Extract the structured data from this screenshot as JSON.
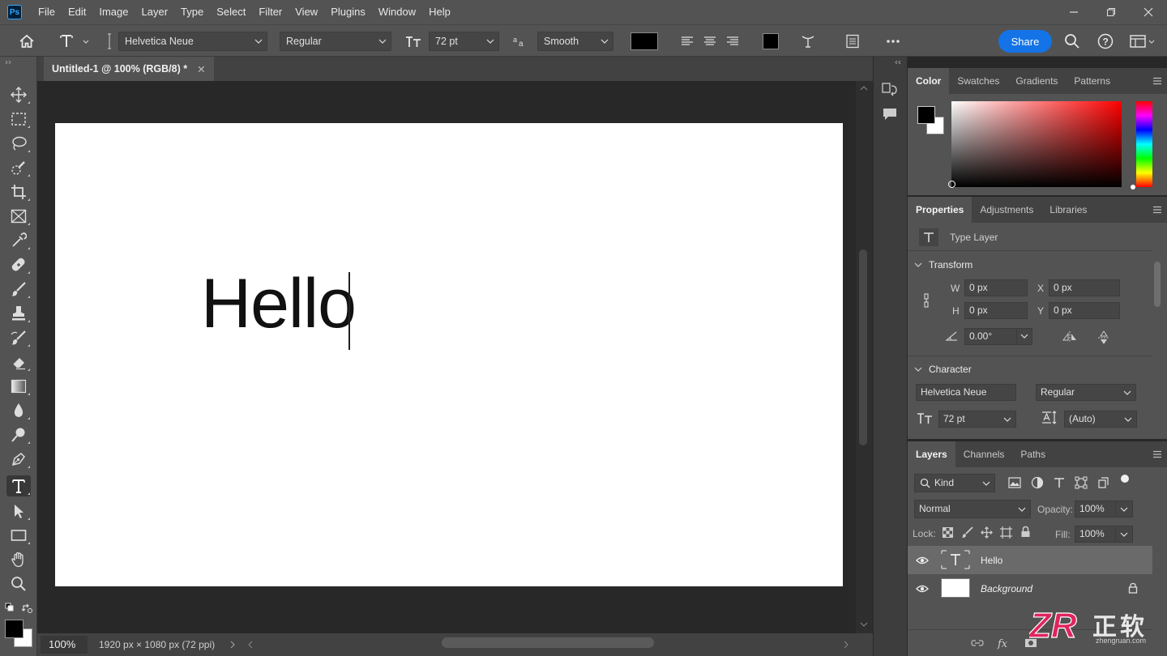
{
  "app": {
    "logo": "Ps"
  },
  "menu": [
    "File",
    "Edit",
    "Image",
    "Layer",
    "Type",
    "Select",
    "Filter",
    "View",
    "Plugins",
    "Window",
    "Help"
  ],
  "window_controls": [
    "minimize-icon",
    "restore-icon",
    "close-icon"
  ],
  "options_bar": {
    "font_family": "Helvetica Neue",
    "font_style": "Regular",
    "font_size": "72 pt",
    "antialias": "Smooth",
    "text_color": "#000000",
    "share_label": "Share"
  },
  "toolbar": {
    "tools": [
      "move-tool-icon",
      "marquee-tool-icon",
      "lasso-tool-icon",
      "quick-select-tool-icon",
      "crop-tool-icon",
      "frame-tool-icon",
      "eyedropper-tool-icon",
      "healing-brush-tool-icon",
      "brush-tool-icon",
      "clone-stamp-tool-icon",
      "history-brush-tool-icon",
      "eraser-tool-icon",
      "gradient-tool-icon",
      "blur-tool-icon",
      "dodge-tool-icon",
      "pen-tool-icon",
      "type-tool-icon",
      "path-select-tool-icon",
      "rectangle-tool-icon",
      "hand-tool-icon",
      "zoom-tool-icon"
    ],
    "active_tool": "type-tool-icon",
    "foreground": "#000000",
    "background": "#ffffff"
  },
  "document": {
    "tab_title": "Untitled-1 @ 100% (RGB/8) *",
    "canvas_text": "Hello",
    "zoom": "100%",
    "info": "1920 px × 1080 px (72 ppi)"
  },
  "color_panel": {
    "tabs": [
      "Color",
      "Swatches",
      "Gradients",
      "Patterns"
    ],
    "active_tab": "Color",
    "hue": "#ff0000"
  },
  "properties_panel": {
    "tabs": [
      "Properties",
      "Adjustments",
      "Libraries"
    ],
    "active_tab": "Properties",
    "layer_type": "Type Layer",
    "transform": {
      "title": "Transform",
      "w_label": "W",
      "w": "0 px",
      "h_label": "H",
      "h": "0 px",
      "x_label": "X",
      "x": "0 px",
      "y_label": "Y",
      "y": "0 px",
      "angle": "0.00°"
    },
    "character": {
      "title": "Character",
      "font_family": "Helvetica Neue",
      "font_style": "Regular",
      "font_size": "72 pt",
      "leading": "(Auto)"
    }
  },
  "layers_panel": {
    "tabs": [
      "Layers",
      "Channels",
      "Paths"
    ],
    "active_tab": "Layers",
    "filter": "Kind",
    "blend_mode": "Normal",
    "opacity_label": "Opacity:",
    "opacity": "100%",
    "lock_label": "Lock:",
    "fill_label": "Fill:",
    "fill": "100%",
    "layers": [
      {
        "name": "Hello",
        "type": "text",
        "selected": true
      },
      {
        "name": "Background",
        "type": "pixel",
        "selected": false,
        "locked": true
      }
    ]
  },
  "watermark": {
    "logo": "ZR",
    "text": "正软",
    "url": "zhengruan.com"
  }
}
